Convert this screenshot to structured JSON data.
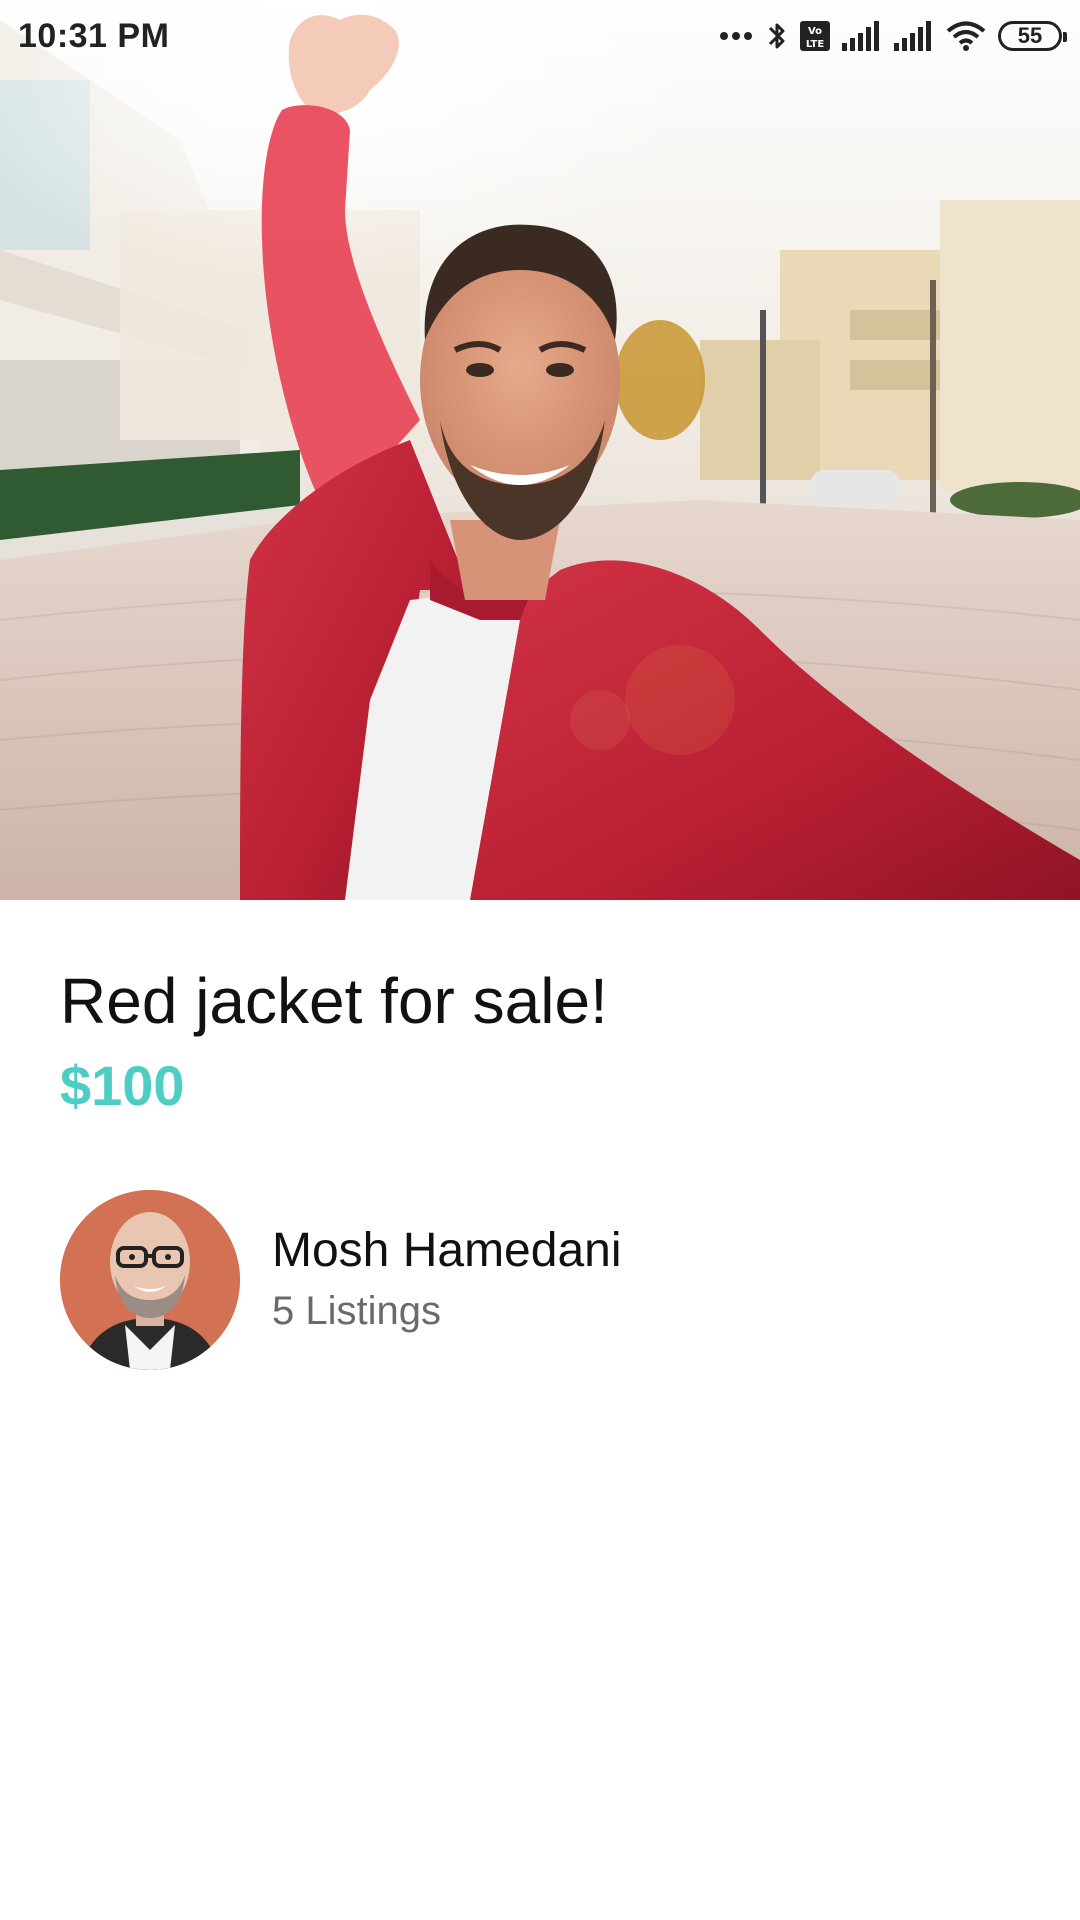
{
  "status_bar": {
    "time": "10:31 PM",
    "battery_level": "55",
    "icons": [
      "more-dots-icon",
      "bluetooth-icon",
      "volte-icon",
      "signal-icon",
      "signal-icon",
      "wifi-icon",
      "battery-icon"
    ]
  },
  "listing": {
    "image": "listing-photo-man-in-red-jacket",
    "title": "Red jacket for sale!",
    "price": "$100"
  },
  "seller": {
    "avatar": "seller-avatar-photo",
    "name": "Mosh Hamedani",
    "listings": "5 Listings"
  },
  "colors": {
    "price_accent": "#4ecdc4",
    "subtitle_gray": "#6e6969",
    "jacket_red": "#c0263a"
  }
}
